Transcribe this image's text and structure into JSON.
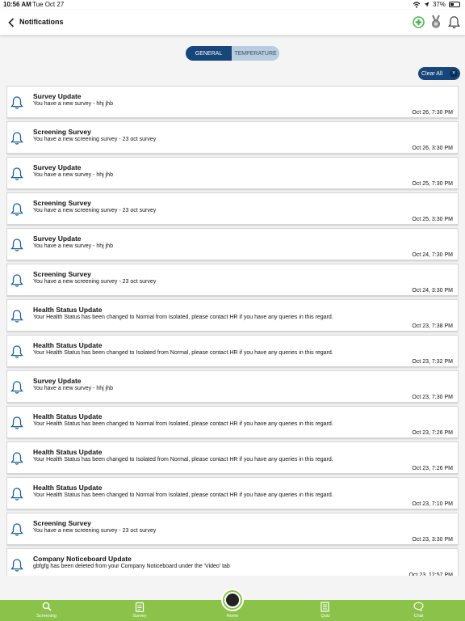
{
  "status_bar": {
    "time": "10:56 AM",
    "date": "Tue Oct 27",
    "battery": "37%",
    "battery_level": 0.37
  },
  "header": {
    "title": "Notifications",
    "back_icon": "chevron-left-icon",
    "icons": [
      "add-circle-icon",
      "medal-icon",
      "bell-icon"
    ],
    "accent_color": "#4caf50"
  },
  "tabs": [
    {
      "label": "GENERAL",
      "active": true
    },
    {
      "label": "TEMPERATURE",
      "active": false
    }
  ],
  "clear_all": {
    "label": "Clear All",
    "icon": "close-icon"
  },
  "colors": {
    "primary": "#17467a",
    "nav_green": "#8bc34a",
    "bell_blue": "#1f5f99"
  },
  "notifications": [
    {
      "title": "Survey Update",
      "message": "You have a new survey - hhj jhb",
      "time": "Oct 26, 7:30 PM"
    },
    {
      "title": "Screening Survey",
      "message": "You have a new screening survey - 23 oct survey",
      "time": "Oct 26, 3:30 PM"
    },
    {
      "title": "Survey Update",
      "message": "You have a new survey - hhj jhb",
      "time": "Oct 25, 7:30 PM"
    },
    {
      "title": "Screening Survey",
      "message": "You have a new screening survey - 23 oct survey",
      "time": "Oct 25, 3:30 PM"
    },
    {
      "title": "Survey Update",
      "message": "You have a new survey - hhj jhb",
      "time": "Oct 24, 7:30 PM"
    },
    {
      "title": "Screening Survey",
      "message": "You have a new screening survey - 23 oct survey",
      "time": "Oct 24, 3:30 PM"
    },
    {
      "title": "Health Status Update",
      "message": "Your Health Status has been changed to Normal from Isolated, please contact HR if you have any queries in this regard.",
      "time": "Oct 23, 7:38 PM"
    },
    {
      "title": "Health Status Update",
      "message": "Your Health Status has been changed to Isolated from Normal, please contact HR if you have any queries in this regard.",
      "time": "Oct 23, 7:32 PM"
    },
    {
      "title": "Survey Update",
      "message": "You have a new survey - hhj jhb",
      "time": "Oct 23, 7:30 PM"
    },
    {
      "title": "Health Status Update",
      "message": "Your Health Status has been changed to Normal from Isolated, please contact HR if you have any queries in this regard.",
      "time": "Oct 23, 7:26 PM"
    },
    {
      "title": "Health Status Update",
      "message": "Your Health Status has been changed to Isolated from Normal, please contact HR if you have any queries in this regard.",
      "time": "Oct 23, 7:26 PM"
    },
    {
      "title": "Health Status Update",
      "message": "Your Health Status has been changed to Normal from Isolated, please contact HR if you have any queries in this regard.",
      "time": "Oct 23, 7:10 PM"
    },
    {
      "title": "Screening Survey",
      "message": "You have a new screening survey - 23 oct survey",
      "time": "Oct 23, 3:30 PM"
    },
    {
      "title": "Company Noticeboard Update",
      "message": "gbfgfg has been deleted from your Company Noticeboard under the 'Video' tab",
      "time": "Oct 23, 12:57 PM"
    }
  ],
  "bottom_nav": [
    {
      "label": "Screening",
      "icon": "search-icon"
    },
    {
      "label": "Survey",
      "icon": "clipboard-icon"
    },
    {
      "label": "Home",
      "icon": "home-icon"
    },
    {
      "label": "Quiz",
      "icon": "document-icon"
    },
    {
      "label": "Chat",
      "icon": "chat-icon"
    }
  ]
}
